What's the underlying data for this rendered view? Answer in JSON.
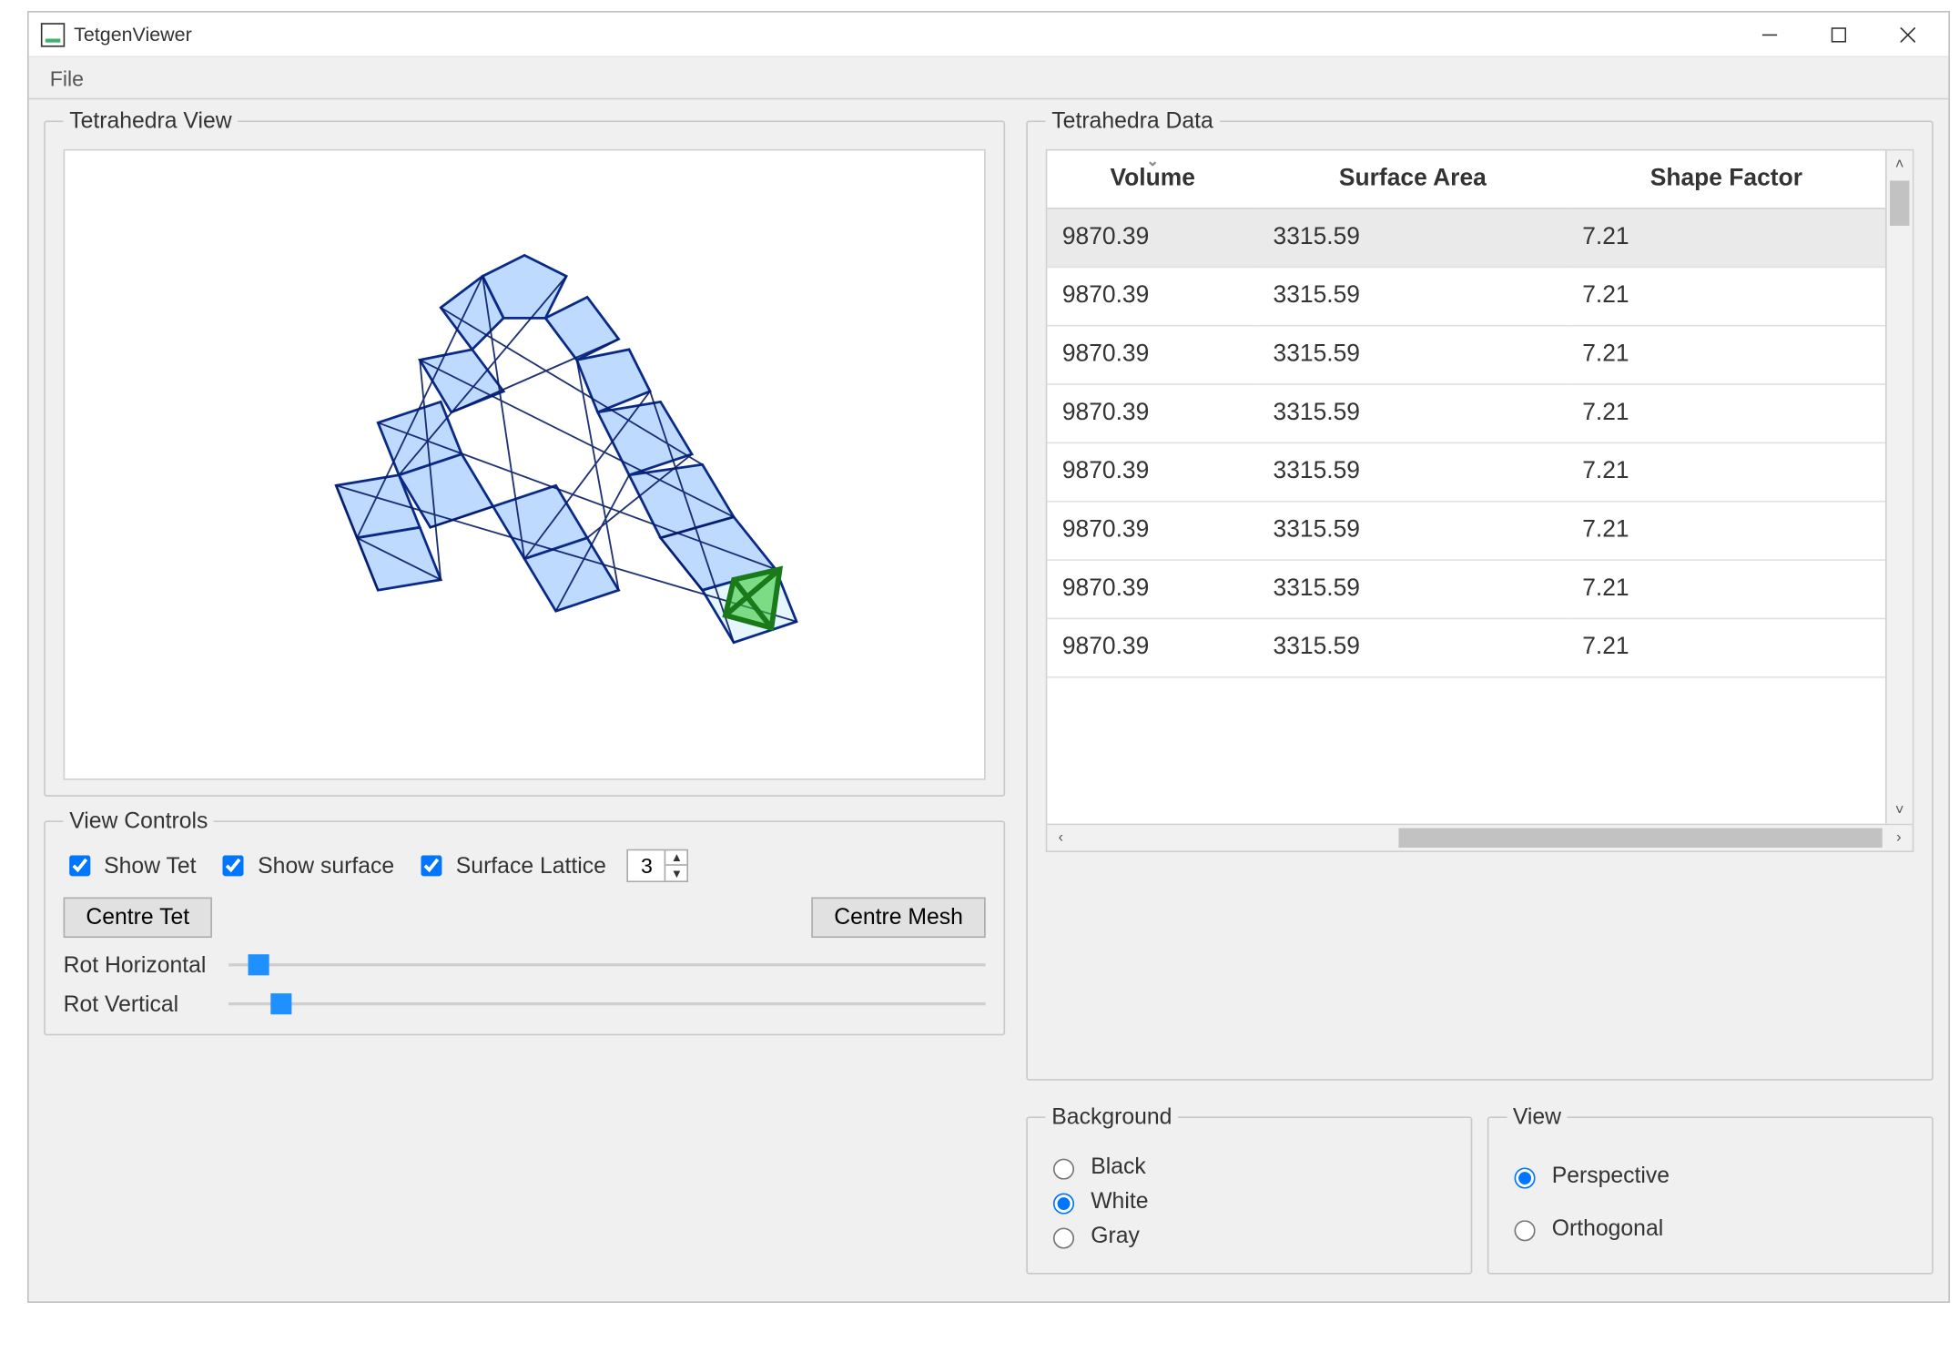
{
  "window": {
    "title": "TetgenViewer",
    "menu": {
      "file": "File"
    }
  },
  "left": {
    "view_group": "Tetrahedra View",
    "controls_group": "View Controls",
    "show_tet": {
      "label": "Show Tet",
      "checked": true
    },
    "show_surface": {
      "label": "Show surface",
      "checked": true
    },
    "surface_lattice": {
      "label": "Surface Lattice",
      "checked": true,
      "value": "3"
    },
    "centre_tet": "Centre Tet",
    "centre_mesh": "Centre Mesh",
    "rot_h": "Rot Horizontal",
    "rot_v": "Rot Vertical"
  },
  "right": {
    "data_group": "Tetrahedra Data",
    "columns": {
      "volume": "Volume",
      "surface_area": "Surface Area",
      "shape_factor": "Shape Factor"
    },
    "rows": [
      {
        "volume": "9870.39",
        "surface_area": "3315.59",
        "shape_factor": "7.21"
      },
      {
        "volume": "9870.39",
        "surface_area": "3315.59",
        "shape_factor": "7.21"
      },
      {
        "volume": "9870.39",
        "surface_area": "3315.59",
        "shape_factor": "7.21"
      },
      {
        "volume": "9870.39",
        "surface_area": "3315.59",
        "shape_factor": "7.21"
      },
      {
        "volume": "9870.39",
        "surface_area": "3315.59",
        "shape_factor": "7.21"
      },
      {
        "volume": "9870.39",
        "surface_area": "3315.59",
        "shape_factor": "7.21"
      },
      {
        "volume": "9870.39",
        "surface_area": "3315.59",
        "shape_factor": "7.21"
      },
      {
        "volume": "9870.39",
        "surface_area": "3315.59",
        "shape_factor": "7.21"
      }
    ],
    "background_group": "Background",
    "bg": {
      "black": "Black",
      "white": "White",
      "gray": "Gray",
      "selected": "white"
    },
    "view_group": "View",
    "view": {
      "perspective": "Perspective",
      "orthogonal": "Orthogonal",
      "selected": "perspective"
    }
  }
}
